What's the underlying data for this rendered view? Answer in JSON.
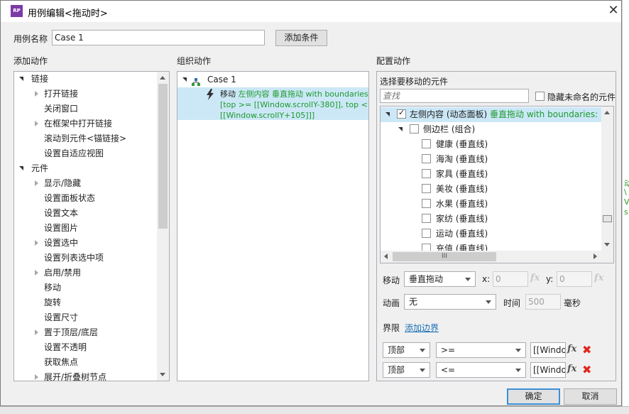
{
  "dialog": {
    "title": "用例编辑<拖动时>",
    "case_name_label": "用例名称",
    "case_name_value": "Case 1",
    "add_condition_button": "添加条件",
    "ok_button": "确定",
    "cancel_button": "取消"
  },
  "add_actions": {
    "header": "添加动作",
    "groups": [
      {
        "label": "链接",
        "items": [
          {
            "label": "打开链接",
            "expandable": true
          },
          {
            "label": "关闭窗口",
            "expandable": false
          },
          {
            "label": "在框架中打开链接",
            "expandable": true
          },
          {
            "label": "滚动到元件<锚链接>",
            "expandable": false
          },
          {
            "label": "设置自适应视图",
            "expandable": false
          }
        ]
      },
      {
        "label": "元件",
        "items": [
          {
            "label": "显示/隐藏",
            "expandable": true
          },
          {
            "label": "设置面板状态",
            "expandable": false
          },
          {
            "label": "设置文本",
            "expandable": false
          },
          {
            "label": "设置图片",
            "expandable": false
          },
          {
            "label": "设置选中",
            "expandable": true
          },
          {
            "label": "设置列表选中项",
            "expandable": false
          },
          {
            "label": "启用/禁用",
            "expandable": true
          },
          {
            "label": "移动",
            "expandable": false
          },
          {
            "label": "旋转",
            "expandable": false
          },
          {
            "label": "设置尺寸",
            "expandable": false
          },
          {
            "label": "置于顶层/底层",
            "expandable": true
          },
          {
            "label": "设置不透明",
            "expandable": false
          },
          {
            "label": "获取焦点",
            "expandable": false
          },
          {
            "label": "展开/折叠树节点",
            "expandable": true
          }
        ]
      }
    ]
  },
  "organize_actions": {
    "header": "组织动作",
    "case_label": "Case 1",
    "action_verb": "移动",
    "action_target": "左侧内容 垂直拖动 with boundaries:",
    "action_line2": "[top >= [[Window.scrollY-380]], top <=",
    "action_line3": "[[Window.scrollY+105]]]"
  },
  "configure_actions": {
    "header": "配置动作",
    "select_label": "选择要移动的元件",
    "search_placeholder": "查找",
    "hide_unnamed_label": "隐藏未命名的元件",
    "tree_root_name": "左侧内容 (动态面板)",
    "tree_root_detail": "垂直拖动 with boundaries: [top >=",
    "tree_group": "侧边栏 (组合)",
    "tree_items": [
      "健康 (垂直线)",
      "海淘 (垂直线)",
      "家具 (垂直线)",
      "美妆 (垂直线)",
      "水果 (垂直线)",
      "家纺 (垂直线)",
      "运动 (垂直线)",
      "充值 (垂直线)"
    ],
    "hscroll_grip": "III",
    "move_label": "移动",
    "move_value": "垂直拖动",
    "x_label": "x:",
    "x_value": "0",
    "y_label": "y:",
    "y_value": "0",
    "fx_label": "fx",
    "anim_label": "动画",
    "anim_value": "无",
    "time_label": "时间",
    "time_value": "500",
    "ms_label": "毫秒",
    "bounds_label": "界限",
    "add_bounds_link": "添加边界",
    "bounds": [
      {
        "edge": "顶部",
        "op": ">=",
        "value": "[[Window"
      },
      {
        "edge": "顶部",
        "op": "<=",
        "value": "[[Window"
      }
    ],
    "delete_glyph": "✖"
  },
  "background": {
    "right_fragments": [
      "动",
      "\\",
      "V",
      "s"
    ]
  }
}
